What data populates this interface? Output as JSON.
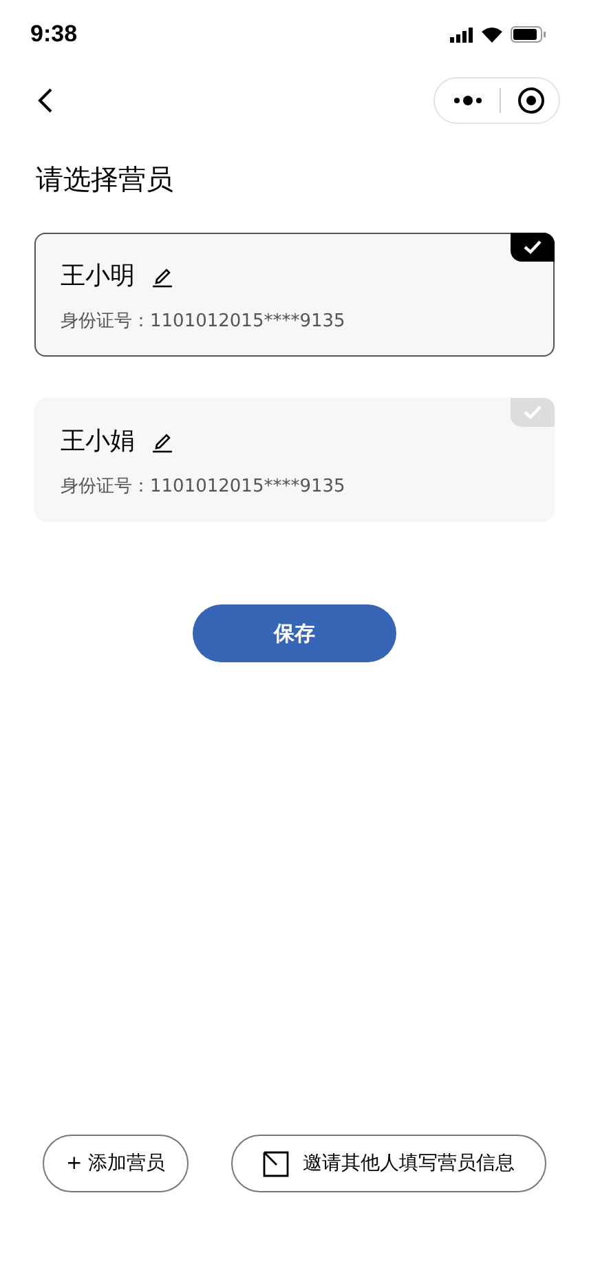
{
  "status_bar": {
    "time": "9:38"
  },
  "title": "请选择营员",
  "campers": [
    {
      "name": "王小明",
      "id_label": "身份证号：1101012015****9135",
      "selected": true
    },
    {
      "name": "王小娟",
      "id_label": "身份证号：1101012015****9135",
      "selected": false
    }
  ],
  "save_button": "保存",
  "bottom_buttons": [
    {
      "kind": "add",
      "label": "+ 添加营员"
    },
    {
      "kind": "invite",
      "label": "邀请其他人填写营员信息"
    }
  ]
}
